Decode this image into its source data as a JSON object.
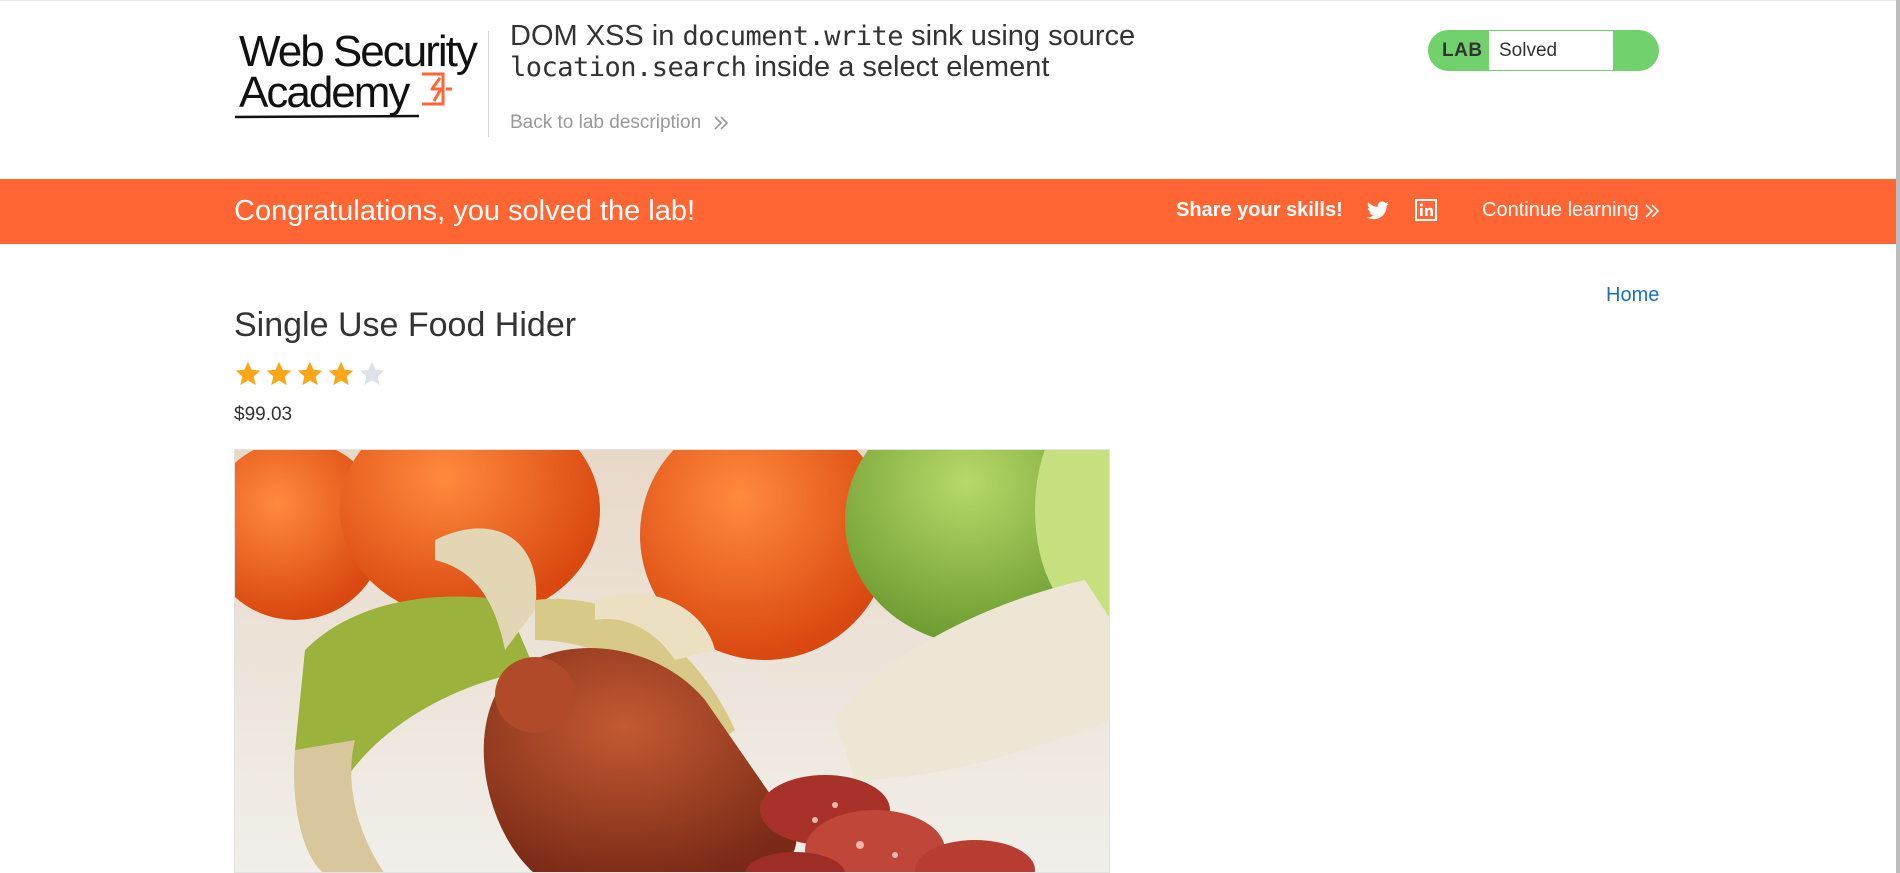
{
  "header": {
    "logo": {
      "line1": "Web Security",
      "line2": "Academy"
    },
    "title": {
      "part1": "DOM XSS in ",
      "code1": "document.write",
      "part2": " sink using source ",
      "code2": "location.search",
      "part3": " inside a select element"
    },
    "back_link": "Back to lab description",
    "status": {
      "badge": "LAB",
      "value": "Solved",
      "color": "#70d16d"
    }
  },
  "banner": {
    "message": "Congratulations, you solved the lab!",
    "share_label": "Share your skills!",
    "continue_label": "Continue learning",
    "color": "#ff6633"
  },
  "nav": {
    "home": "Home"
  },
  "product": {
    "name": "Single Use Food Hider",
    "rating": 4,
    "rating_max": 5,
    "price": "$99.03"
  },
  "icons": {
    "twitter": "twitter-icon",
    "linkedin": "linkedin-icon",
    "chevrons": "double-chevron-right-icon",
    "star": "star-icon"
  }
}
